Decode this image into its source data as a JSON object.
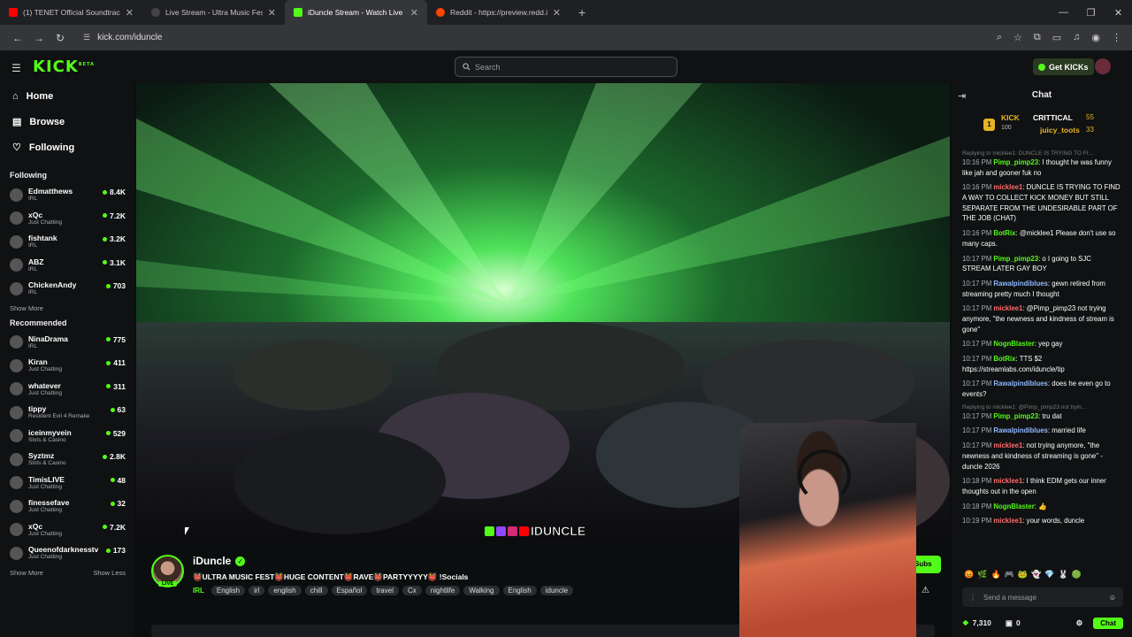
{
  "browser": {
    "tabs": [
      {
        "title": "(1) TENET Official Soundtrack |",
        "color": "#ff0000"
      },
      {
        "title": "Live Stream - Ultra Music Festiv",
        "color": "#444"
      },
      {
        "title": "iDuncle Stream - Watch Live on",
        "color": "#53fc18"
      },
      {
        "title": "Reddit - https://preview.redd.it",
        "color": "#ff4500"
      }
    ],
    "url": "kick.com/iduncle",
    "new_tab": "+"
  },
  "header": {
    "logo": "KICK",
    "logo_badge": "BETA",
    "search_placeholder": "Search",
    "get_kicks": "Get KICKs"
  },
  "sidebar": {
    "nav": [
      {
        "label": "Home",
        "icon": "home-icon"
      },
      {
        "label": "Browse",
        "icon": "browse-icon"
      },
      {
        "label": "Following",
        "icon": "heart-icon"
      }
    ],
    "following_title": "Following",
    "following": [
      {
        "name": "Edmatthews",
        "category": "IRL",
        "viewers": "8.4K"
      },
      {
        "name": "xQc",
        "category": "Just Chatting",
        "viewers": "7.2K"
      },
      {
        "name": "fishtank",
        "category": "IRL",
        "viewers": "3.2K"
      },
      {
        "name": "ABZ",
        "category": "IRL",
        "viewers": "3.1K"
      },
      {
        "name": "ChickenAndy",
        "category": "IRL",
        "viewers": "703"
      }
    ],
    "show_more_1": "Show More",
    "recommended_title": "Recommended",
    "recommended": [
      {
        "name": "NinaDrama",
        "category": "IRL",
        "viewers": "775"
      },
      {
        "name": "Kiran",
        "category": "Just Chatting",
        "viewers": "411"
      },
      {
        "name": "whatever",
        "category": "Just Chatting",
        "viewers": "311"
      },
      {
        "name": "tippy",
        "category": "Resident Evil 4 Remake",
        "viewers": "63"
      },
      {
        "name": "iceinmyvein",
        "category": "Slots & Casino",
        "viewers": "529"
      },
      {
        "name": "Syztmz",
        "category": "Slots & Casino",
        "viewers": "2.8K"
      },
      {
        "name": "TimisLIVE",
        "category": "Just Chatting",
        "viewers": "48"
      },
      {
        "name": "finessefave",
        "category": "Just Chatting",
        "viewers": "32"
      },
      {
        "name": "xQc",
        "category": "Just Chatting",
        "viewers": "7.2K"
      },
      {
        "name": "Queenofdarknesstv",
        "category": "Just Chatting",
        "viewers": "173"
      }
    ],
    "show_more_2": "Show More",
    "show_less": "Show Less"
  },
  "stream": {
    "streamer": "iDuncle",
    "live_badge": "LIVE",
    "title": "👹ULTRA MUSIC FEST👹HUGE CONTENT👹RAVE👹PARTYYYYY👹 !Socials",
    "category": "IRL",
    "tags": [
      "English",
      "irl",
      "english",
      "chill",
      "Español",
      "travel",
      "Cx",
      "nightlife",
      "Walking",
      "English",
      "iduncle"
    ],
    "overlay_name": "IDUNCLE",
    "subs_button": "Subs"
  },
  "chat": {
    "title": "Chat",
    "leaderboard": [
      {
        "name": "KICK",
        "points": "100"
      },
      {
        "name": "CRITTICAL",
        "points": "55"
      },
      {
        "name": "juicy_toots",
        "points": "33"
      }
    ],
    "messages": [
      {
        "reply": "Replying to micklee1: DUNCLE IS TRYING TO FI...",
        "time": "10:16 PM",
        "user": "Pimp_pimp23",
        "color": "#53fc18",
        "text": "I thought he was funny like jah and gooner fuk no"
      },
      {
        "reply": "",
        "time": "10:16 PM",
        "user": "micklee1",
        "color": "#ff6b6b",
        "text": "DUNCLE IS TRYING TO FIND A WAY TO COLLECT KICK MONEY BUT STILL SEPARATE FROM THE UNDESIRABLE PART OF THE JOB (CHAT)"
      },
      {
        "reply": "",
        "time": "10:16 PM",
        "user": "BotRix",
        "color": "#53fc18",
        "text": "@micklee1 Please don't use so many caps."
      },
      {
        "reply": "",
        "time": "10:17 PM",
        "user": "Pimp_pimp23",
        "color": "#53fc18",
        "text": "o I going to SJC STREAM LATER GAY BOY"
      },
      {
        "reply": "",
        "time": "10:17 PM",
        "user": "Rawalpindiblues",
        "color": "#8fb8ff",
        "text": "gewn retired from streaming pretty much I thought"
      },
      {
        "reply": "",
        "time": "10:17 PM",
        "user": "micklee1",
        "color": "#ff6b6b",
        "text": "@Pimp_pimp23 not trying anymore, \"the newness and kindness of stream is gone\""
      },
      {
        "reply": "",
        "time": "10:17 PM",
        "user": "NognBlaster",
        "color": "#53fc18",
        "text": "yep gay"
      },
      {
        "reply": "",
        "time": "10:17 PM",
        "user": "BotRix",
        "color": "#53fc18",
        "text": "TTS $2 https://streamlabs.com/iduncle/tip"
      },
      {
        "reply": "",
        "time": "10:17 PM",
        "user": "Rawalpindiblues",
        "color": "#8fb8ff",
        "text": "does he even go to events?"
      },
      {
        "reply": "Replying to micklee1: @Pimp_pimp23 not tryin...",
        "time": "10:17 PM",
        "user": "Pimp_pimp23",
        "color": "#53fc18",
        "text": "tru dat"
      },
      {
        "reply": "",
        "time": "10:17 PM",
        "user": "Rawalpindiblues",
        "color": "#8fb8ff",
        "text": "married life"
      },
      {
        "reply": "",
        "time": "10:17 PM",
        "user": "micklee1",
        "color": "#ff6b6b",
        "text": "not trying anymore, \"the newness and kindness of streaming is gone\" - duncle 2026"
      },
      {
        "reply": "",
        "time": "10:18 PM",
        "user": "micklee1",
        "color": "#ff6b6b",
        "text": "I think EDM gets our inner thoughts out in the open"
      },
      {
        "reply": "",
        "time": "10:18 PM",
        "user": "NognBlaster",
        "color": "#53fc18",
        "text": "👍"
      },
      {
        "reply": "",
        "time": "10:19 PM",
        "user": "micklee1",
        "color": "#ff6b6b",
        "text": "your words, duncle"
      }
    ],
    "input_placeholder": "Send a message",
    "kicks_balance": "7,310",
    "points": "0",
    "chat_button": "Chat"
  }
}
